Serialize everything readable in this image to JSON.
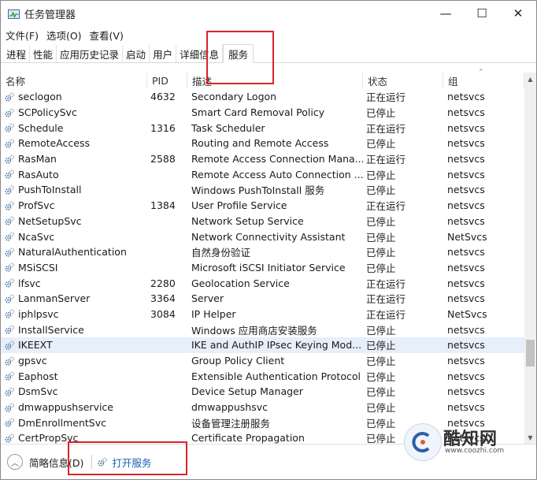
{
  "window": {
    "title": "任务管理器",
    "controls": {
      "minimize": "—",
      "maximize": "☐",
      "close": "✕"
    }
  },
  "menu": {
    "file": "文件(F)",
    "options": "选项(O)",
    "view": "查看(V)"
  },
  "tabs": [
    {
      "label": "进程"
    },
    {
      "label": "性能"
    },
    {
      "label": "应用历史记录"
    },
    {
      "label": "启动"
    },
    {
      "label": "用户"
    },
    {
      "label": "详细信息"
    },
    {
      "label": "服务",
      "active": true
    }
  ],
  "table": {
    "headers": {
      "name": "名称",
      "pid": "PID",
      "desc": "描述",
      "status": "状态",
      "group": "组"
    },
    "rows": [
      {
        "name": "seclogon",
        "pid": "4632",
        "desc": "Secondary Logon",
        "status": "正在运行",
        "group": "netsvcs"
      },
      {
        "name": "SCPolicySvc",
        "pid": "",
        "desc": "Smart Card Removal Policy",
        "status": "已停止",
        "group": "netsvcs"
      },
      {
        "name": "Schedule",
        "pid": "1316",
        "desc": "Task Scheduler",
        "status": "正在运行",
        "group": "netsvcs"
      },
      {
        "name": "RemoteAccess",
        "pid": "",
        "desc": "Routing and Remote Access",
        "status": "已停止",
        "group": "netsvcs"
      },
      {
        "name": "RasMan",
        "pid": "2588",
        "desc": "Remote Access Connection Mana...",
        "status": "正在运行",
        "group": "netsvcs"
      },
      {
        "name": "RasAuto",
        "pid": "",
        "desc": "Remote Access Auto Connection ...",
        "status": "已停止",
        "group": "netsvcs"
      },
      {
        "name": "PushToInstall",
        "pid": "",
        "desc": "Windows PushToInstall 服务",
        "status": "已停止",
        "group": "netsvcs"
      },
      {
        "name": "ProfSvc",
        "pid": "1384",
        "desc": "User Profile Service",
        "status": "正在运行",
        "group": "netsvcs"
      },
      {
        "name": "NetSetupSvc",
        "pid": "",
        "desc": "Network Setup Service",
        "status": "已停止",
        "group": "netsvcs"
      },
      {
        "name": "NcaSvc",
        "pid": "",
        "desc": "Network Connectivity Assistant",
        "status": "已停止",
        "group": "NetSvcs"
      },
      {
        "name": "NaturalAuthentication",
        "pid": "",
        "desc": "自然身份验证",
        "status": "已停止",
        "group": "netsvcs"
      },
      {
        "name": "MSiSCSI",
        "pid": "",
        "desc": "Microsoft iSCSI Initiator Service",
        "status": "已停止",
        "group": "netsvcs"
      },
      {
        "name": "lfsvc",
        "pid": "2280",
        "desc": "Geolocation Service",
        "status": "正在运行",
        "group": "netsvcs"
      },
      {
        "name": "LanmanServer",
        "pid": "3364",
        "desc": "Server",
        "status": "正在运行",
        "group": "netsvcs"
      },
      {
        "name": "iphlpsvc",
        "pid": "3084",
        "desc": "IP Helper",
        "status": "正在运行",
        "group": "NetSvcs"
      },
      {
        "name": "InstallService",
        "pid": "",
        "desc": "Windows 应用商店安装服务",
        "status": "已停止",
        "group": "netsvcs"
      },
      {
        "name": "IKEEXT",
        "pid": "",
        "desc": "IKE and AuthIP IPsec Keying Mod...",
        "status": "已停止",
        "group": "netsvcs",
        "selected": true
      },
      {
        "name": "gpsvc",
        "pid": "",
        "desc": "Group Policy Client",
        "status": "已停止",
        "group": "netsvcs"
      },
      {
        "name": "Eaphost",
        "pid": "",
        "desc": "Extensible Authentication Protocol",
        "status": "已停止",
        "group": "netsvcs"
      },
      {
        "name": "DsmSvc",
        "pid": "",
        "desc": "Device Setup Manager",
        "status": "已停止",
        "group": "netsvcs"
      },
      {
        "name": "dmwappushservice",
        "pid": "",
        "desc": "dmwappushsvc",
        "status": "已停止",
        "group": "netsvcs"
      },
      {
        "name": "DmEnrollmentSvc",
        "pid": "",
        "desc": "设备管理注册服务",
        "status": "已停止",
        "group": "netsvcs"
      },
      {
        "name": "CertPropSvc",
        "pid": "",
        "desc": "Certificate Propagation",
        "status": "已停止",
        "group": "netsvcs"
      }
    ]
  },
  "footer": {
    "fewer_details": "简略信息(D)",
    "open_services": "打开服务"
  },
  "watermark": {
    "brand": "酷知网",
    "url": "www.coozhi.com"
  },
  "colors": {
    "annotation_red": "#d9242a",
    "link_blue": "#1a5fb4",
    "selected_row": "#e6effa"
  }
}
